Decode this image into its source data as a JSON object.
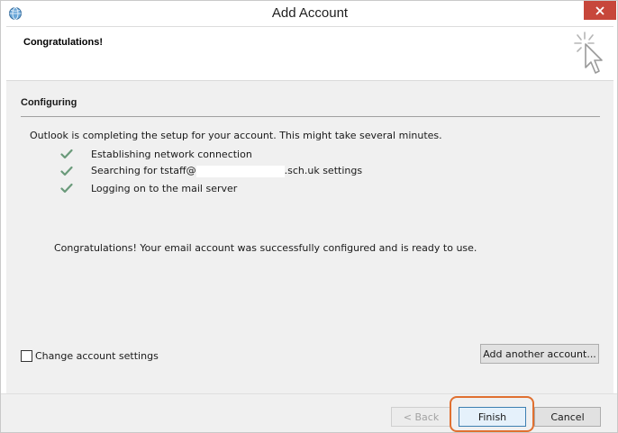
{
  "window": {
    "title": "Add Account",
    "icon": "outlook-globe-icon",
    "close_icon": "close-icon"
  },
  "header": {
    "title": "Congratulations!",
    "icon": "wizard-cursor-icon"
  },
  "configuring": {
    "title": "Configuring",
    "status": "Outlook is completing the setup for your account. This might take several minutes.",
    "steps": [
      {
        "label": "Establishing network connection",
        "status": "done"
      },
      {
        "label_prefix": "Searching for tstaff@",
        "label_suffix": ".sch.uk settings",
        "status": "done"
      },
      {
        "label": "Logging on to the mail server",
        "status": "done"
      }
    ],
    "success": "Congratulations! Your email account was successfully configured and is ready to use."
  },
  "options": {
    "change_settings_label": "Change account settings",
    "change_settings_checked": false,
    "add_another_label": "Add another account..."
  },
  "footer": {
    "back_label": "< Back",
    "finish_label": "Finish",
    "cancel_label": "Cancel"
  },
  "colors": {
    "check": "#6a9a7a",
    "highlight": "#e07030",
    "close": "#c7473b"
  }
}
